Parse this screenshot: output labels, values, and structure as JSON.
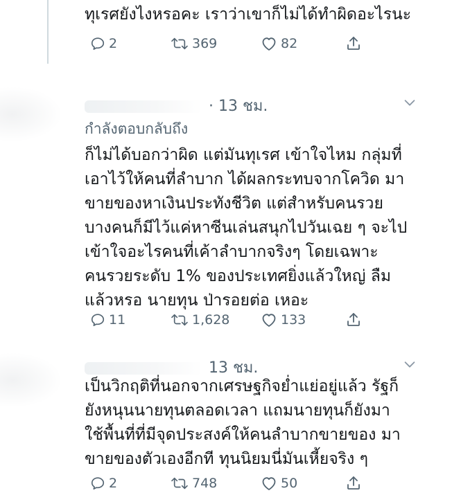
{
  "tweets": [
    {
      "body_lines": [
        "ทุเรศยังไงหรอคะ เราว่าเขาก็ไม่ได้ทำผิดอะไรนะ"
      ],
      "replies": "2",
      "retweets": "369",
      "likes": "82"
    },
    {
      "time": "· 13 ชม.",
      "reply_to": "กำลังตอบกลับถึง",
      "body_lines": [
        "ก็ไม่ได้บอกว่าผิด แต่มันทุเรศ เข้าใจไหม กลุ่มที่",
        "เอาไว้ให้คนที่ลำบาก ได้ผลกระทบจากโควิด มา",
        "ขายของหาเงินประทังชีวิต แต่สำหรับคนรวย",
        "บางคนก็มีไว้แค่หาซีนเล่นสนุกไปวันเฉย ๆ จะไป",
        "เข้าใจอะไรคนที่เค้าลำบากจริงๆ โดยเฉพาะ",
        "คนรวยระดับ 1% ของประเทศยิ่งแล้วใหญ่ ลืม",
        "แล้วหรอ นายทุน ป่ารอยต่อ เหอะ"
      ],
      "replies": "11",
      "retweets": "1,628",
      "likes": "133"
    },
    {
      "time": "13 ชม.",
      "body_lines": [
        "เป็นวิกฤติที่นอกจากเศรษฐกิจย่ำแย่อยู่แล้ว รัฐก็",
        "ยังหนุนนายทุนตลอดเวลา แถมนายทุนก็ยังมา",
        "ใช้พื้นที่ที่มีจุดประสงค์ให้คนลำบากขายของ มา",
        "ขายของตัวเองอีกที ทุนนิยมนี่มันเหี้ยจริง ๆ"
      ],
      "replies": "2",
      "retweets": "748",
      "likes": "50"
    }
  ],
  "icons": {
    "reply": "reply-icon",
    "retweet": "retweet-icon",
    "like": "like-icon",
    "share": "share-icon",
    "caret": "chevron-down-icon"
  },
  "colors": {
    "text": "#14171a",
    "muted": "#536471",
    "thread_line": "#cfd9de"
  }
}
